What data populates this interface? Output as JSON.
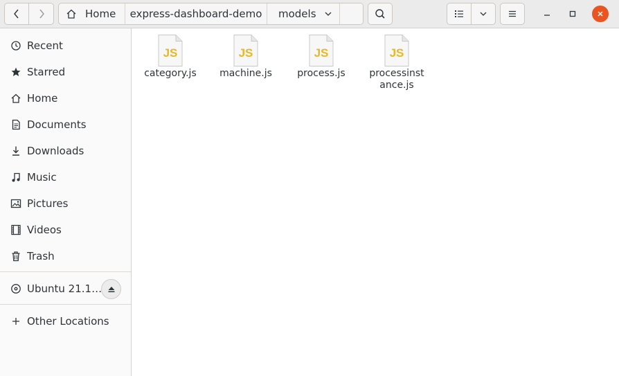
{
  "header": {
    "path": [
      "Home",
      "express-dashboard-demo",
      "models"
    ]
  },
  "sidebar": {
    "items": [
      {
        "label": "Recent",
        "icon": "clock-icon"
      },
      {
        "label": "Starred",
        "icon": "star-icon"
      },
      {
        "label": "Home",
        "icon": "home-icon"
      },
      {
        "label": "Documents",
        "icon": "document-icon"
      },
      {
        "label": "Downloads",
        "icon": "download-icon"
      },
      {
        "label": "Music",
        "icon": "music-icon"
      },
      {
        "label": "Pictures",
        "icon": "picture-icon"
      },
      {
        "label": "Videos",
        "icon": "video-icon"
      },
      {
        "label": "Trash",
        "icon": "trash-icon"
      }
    ],
    "device": {
      "label": "Ubuntu 21.1…",
      "icon": "disc-icon"
    },
    "other": {
      "label": "Other Locations",
      "icon": "plus-icon"
    }
  },
  "files": [
    {
      "name": "category.js",
      "badge": "JS"
    },
    {
      "name": "machine.js",
      "badge": "JS"
    },
    {
      "name": "process.js",
      "badge": "JS"
    },
    {
      "name": "processinst ance.js",
      "badge": "JS"
    }
  ],
  "colors": {
    "accent": "#e95420",
    "js_badge": "#e8b824"
  }
}
